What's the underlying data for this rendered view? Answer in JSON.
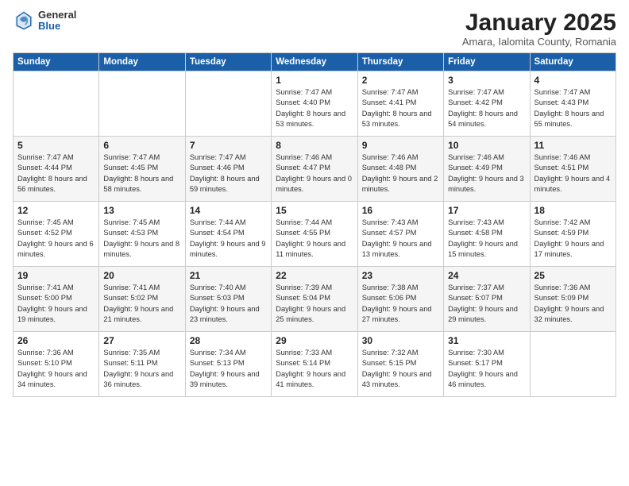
{
  "logo": {
    "general": "General",
    "blue": "Blue"
  },
  "title": "January 2025",
  "subtitle": "Amara, Ialomita County, Romania",
  "days_of_week": [
    "Sunday",
    "Monday",
    "Tuesday",
    "Wednesday",
    "Thursday",
    "Friday",
    "Saturday"
  ],
  "weeks": [
    [
      {
        "day": "",
        "info": ""
      },
      {
        "day": "",
        "info": ""
      },
      {
        "day": "",
        "info": ""
      },
      {
        "day": "1",
        "info": "Sunrise: 7:47 AM\nSunset: 4:40 PM\nDaylight: 8 hours\nand 53 minutes."
      },
      {
        "day": "2",
        "info": "Sunrise: 7:47 AM\nSunset: 4:41 PM\nDaylight: 8 hours\nand 53 minutes."
      },
      {
        "day": "3",
        "info": "Sunrise: 7:47 AM\nSunset: 4:42 PM\nDaylight: 8 hours\nand 54 minutes."
      },
      {
        "day": "4",
        "info": "Sunrise: 7:47 AM\nSunset: 4:43 PM\nDaylight: 8 hours\nand 55 minutes."
      }
    ],
    [
      {
        "day": "5",
        "info": "Sunrise: 7:47 AM\nSunset: 4:44 PM\nDaylight: 8 hours\nand 56 minutes."
      },
      {
        "day": "6",
        "info": "Sunrise: 7:47 AM\nSunset: 4:45 PM\nDaylight: 8 hours\nand 58 minutes."
      },
      {
        "day": "7",
        "info": "Sunrise: 7:47 AM\nSunset: 4:46 PM\nDaylight: 8 hours\nand 59 minutes."
      },
      {
        "day": "8",
        "info": "Sunrise: 7:46 AM\nSunset: 4:47 PM\nDaylight: 9 hours\nand 0 minutes."
      },
      {
        "day": "9",
        "info": "Sunrise: 7:46 AM\nSunset: 4:48 PM\nDaylight: 9 hours\nand 2 minutes."
      },
      {
        "day": "10",
        "info": "Sunrise: 7:46 AM\nSunset: 4:49 PM\nDaylight: 9 hours\nand 3 minutes."
      },
      {
        "day": "11",
        "info": "Sunrise: 7:46 AM\nSunset: 4:51 PM\nDaylight: 9 hours\nand 4 minutes."
      }
    ],
    [
      {
        "day": "12",
        "info": "Sunrise: 7:45 AM\nSunset: 4:52 PM\nDaylight: 9 hours\nand 6 minutes."
      },
      {
        "day": "13",
        "info": "Sunrise: 7:45 AM\nSunset: 4:53 PM\nDaylight: 9 hours\nand 8 minutes."
      },
      {
        "day": "14",
        "info": "Sunrise: 7:44 AM\nSunset: 4:54 PM\nDaylight: 9 hours\nand 9 minutes."
      },
      {
        "day": "15",
        "info": "Sunrise: 7:44 AM\nSunset: 4:55 PM\nDaylight: 9 hours\nand 11 minutes."
      },
      {
        "day": "16",
        "info": "Sunrise: 7:43 AM\nSunset: 4:57 PM\nDaylight: 9 hours\nand 13 minutes."
      },
      {
        "day": "17",
        "info": "Sunrise: 7:43 AM\nSunset: 4:58 PM\nDaylight: 9 hours\nand 15 minutes."
      },
      {
        "day": "18",
        "info": "Sunrise: 7:42 AM\nSunset: 4:59 PM\nDaylight: 9 hours\nand 17 minutes."
      }
    ],
    [
      {
        "day": "19",
        "info": "Sunrise: 7:41 AM\nSunset: 5:00 PM\nDaylight: 9 hours\nand 19 minutes."
      },
      {
        "day": "20",
        "info": "Sunrise: 7:41 AM\nSunset: 5:02 PM\nDaylight: 9 hours\nand 21 minutes."
      },
      {
        "day": "21",
        "info": "Sunrise: 7:40 AM\nSunset: 5:03 PM\nDaylight: 9 hours\nand 23 minutes."
      },
      {
        "day": "22",
        "info": "Sunrise: 7:39 AM\nSunset: 5:04 PM\nDaylight: 9 hours\nand 25 minutes."
      },
      {
        "day": "23",
        "info": "Sunrise: 7:38 AM\nSunset: 5:06 PM\nDaylight: 9 hours\nand 27 minutes."
      },
      {
        "day": "24",
        "info": "Sunrise: 7:37 AM\nSunset: 5:07 PM\nDaylight: 9 hours\nand 29 minutes."
      },
      {
        "day": "25",
        "info": "Sunrise: 7:36 AM\nSunset: 5:09 PM\nDaylight: 9 hours\nand 32 minutes."
      }
    ],
    [
      {
        "day": "26",
        "info": "Sunrise: 7:36 AM\nSunset: 5:10 PM\nDaylight: 9 hours\nand 34 minutes."
      },
      {
        "day": "27",
        "info": "Sunrise: 7:35 AM\nSunset: 5:11 PM\nDaylight: 9 hours\nand 36 minutes."
      },
      {
        "day": "28",
        "info": "Sunrise: 7:34 AM\nSunset: 5:13 PM\nDaylight: 9 hours\nand 39 minutes."
      },
      {
        "day": "29",
        "info": "Sunrise: 7:33 AM\nSunset: 5:14 PM\nDaylight: 9 hours\nand 41 minutes."
      },
      {
        "day": "30",
        "info": "Sunrise: 7:32 AM\nSunset: 5:15 PM\nDaylight: 9 hours\nand 43 minutes."
      },
      {
        "day": "31",
        "info": "Sunrise: 7:30 AM\nSunset: 5:17 PM\nDaylight: 9 hours\nand 46 minutes."
      },
      {
        "day": "",
        "info": ""
      }
    ]
  ]
}
